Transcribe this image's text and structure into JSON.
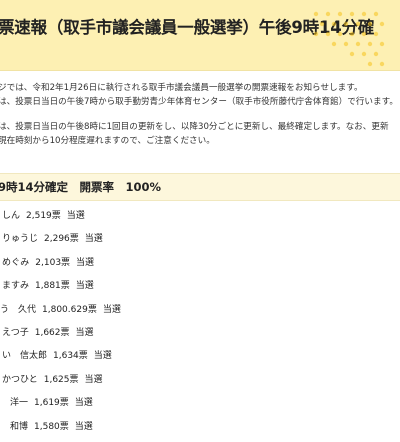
{
  "banner": {
    "title": "票速報（取手市議会議員一般選挙）午後9時14分確"
  },
  "intro": {
    "line1": "ジでは、令和2年1月26日に執行される取手市議会議員一般選挙の開票速報をお知らせします。",
    "line2": "は、投票日当日の午後7時から取手勤労青少年体育センター（取手市役所藤代庁舎体育館）で行います。",
    "line3": "は、投票日当日の午後8時に1回目の更新をし、以降30分ごとに更新し、最終確定します。なお、更新",
    "line4": "現在時刻から10分程度遅れますので、ご注意ください。"
  },
  "section": {
    "title": "9時14分確定　開票率　100%"
  },
  "results": [
    {
      "name": "しん",
      "votes": "2,519票",
      "status": "当選"
    },
    {
      "name": "りゅうじ",
      "votes": "2,296票",
      "status": "当選"
    },
    {
      "name": "めぐみ",
      "votes": "2,103票",
      "status": "当選"
    },
    {
      "name": "ますみ",
      "votes": "1,881票",
      "status": "当選"
    },
    {
      "name": "う　久代",
      "votes": "1,800.629票",
      "status": "当選"
    },
    {
      "name": "えつ子",
      "votes": "1,662票",
      "status": "当選"
    },
    {
      "name": "い　信太郎",
      "votes": "1,634票",
      "status": "当選"
    },
    {
      "name": "かつひと",
      "votes": "1,625票",
      "status": "当選"
    },
    {
      "name": "洋一",
      "votes": "1,619票",
      "status": "当選"
    },
    {
      "name": "和博",
      "votes": "1,580票",
      "status": "当選"
    }
  ]
}
